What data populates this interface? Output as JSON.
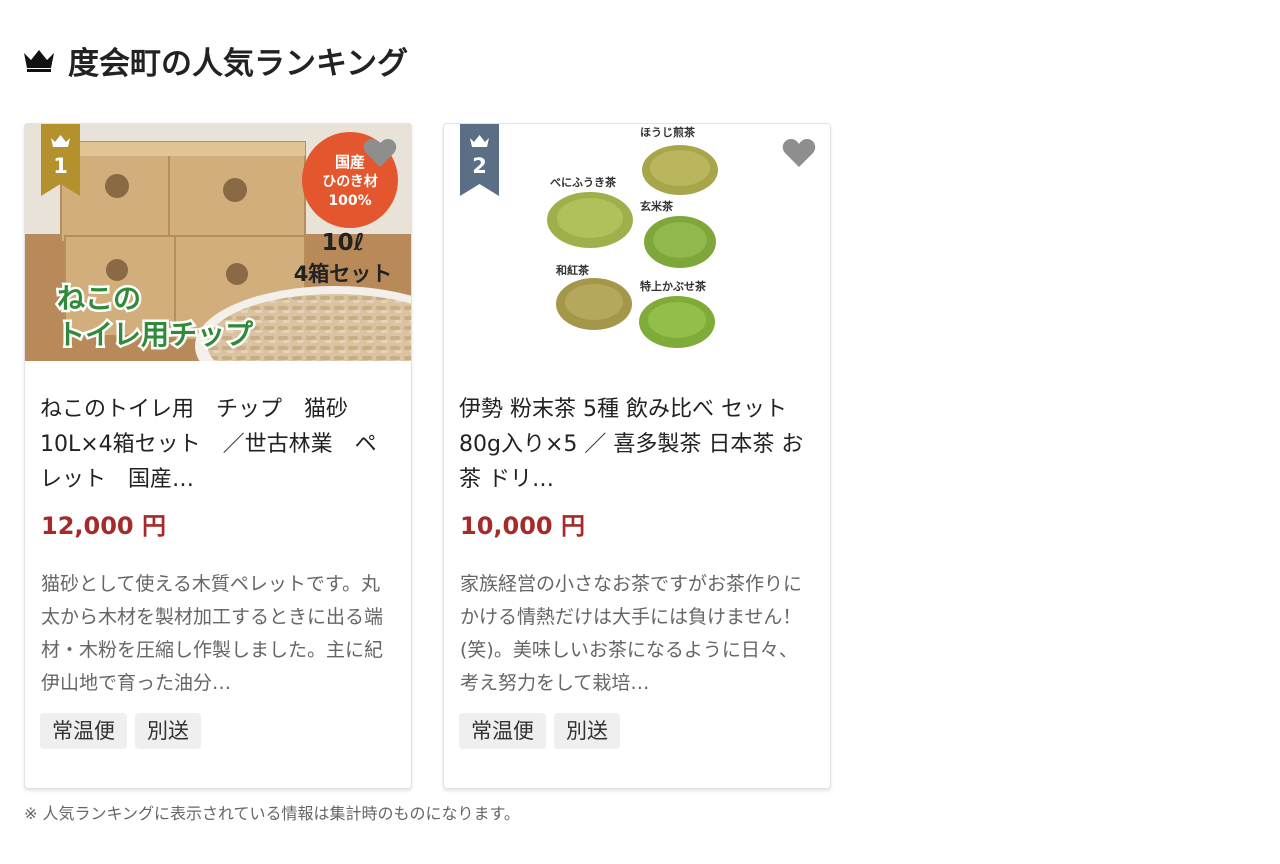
{
  "section": {
    "title": "度会町の人気ランキング",
    "crown_icon": "crown-icon"
  },
  "products": [
    {
      "rank": "1",
      "rank_color": "#b3922e",
      "title": "ねこのトイレ用　チップ　猫砂　10L×4箱セット　／世古林業　ペレット　国産…",
      "price": "12,000 円",
      "description": "猫砂として使える木質ペレットです。丸太から木材を製材加工するときに出る端材・木粉を圧縮し作製しました。主に紀伊山地で育った油分…",
      "tags": [
        "常温便",
        "別送"
      ],
      "image": {
        "badge_line1": "国産",
        "badge_line2": "ひのき材",
        "badge_line3": "100%",
        "volume": "10ℓ",
        "set": "4箱セット",
        "banner_line1": "ねこの",
        "banner_line2": "トイレ用チップ"
      }
    },
    {
      "rank": "2",
      "rank_color": "#5a6f86",
      "title": "伊勢 粉末茶 5種 飲み比べ セット 80g入り×5 ／ 喜多製茶 日本茶 お茶 ドリ…",
      "price": "10,000 円",
      "description": "家族経営の小さなお茶ですがお茶作りにかける情熱だけは大手には負けません！(笑)。美味しいお茶になるように日々、考え努力をして栽培…",
      "tags": [
        "常温便",
        "別送"
      ],
      "image": {
        "label_hojicha": "ほうじ煎茶",
        "label_benifuuki": "べにふうき茶",
        "label_genmaicha": "玄米茶",
        "label_wakocha": "和紅茶",
        "label_kabusecha": "特上かぶせ茶"
      }
    }
  ],
  "footer_note": "※ 人気ランキングに表示されている情報は集計時のものになります。",
  "colors": {
    "price": "#a52a2a",
    "tag_bg": "#efefef",
    "heart": "#8e8e8e"
  }
}
